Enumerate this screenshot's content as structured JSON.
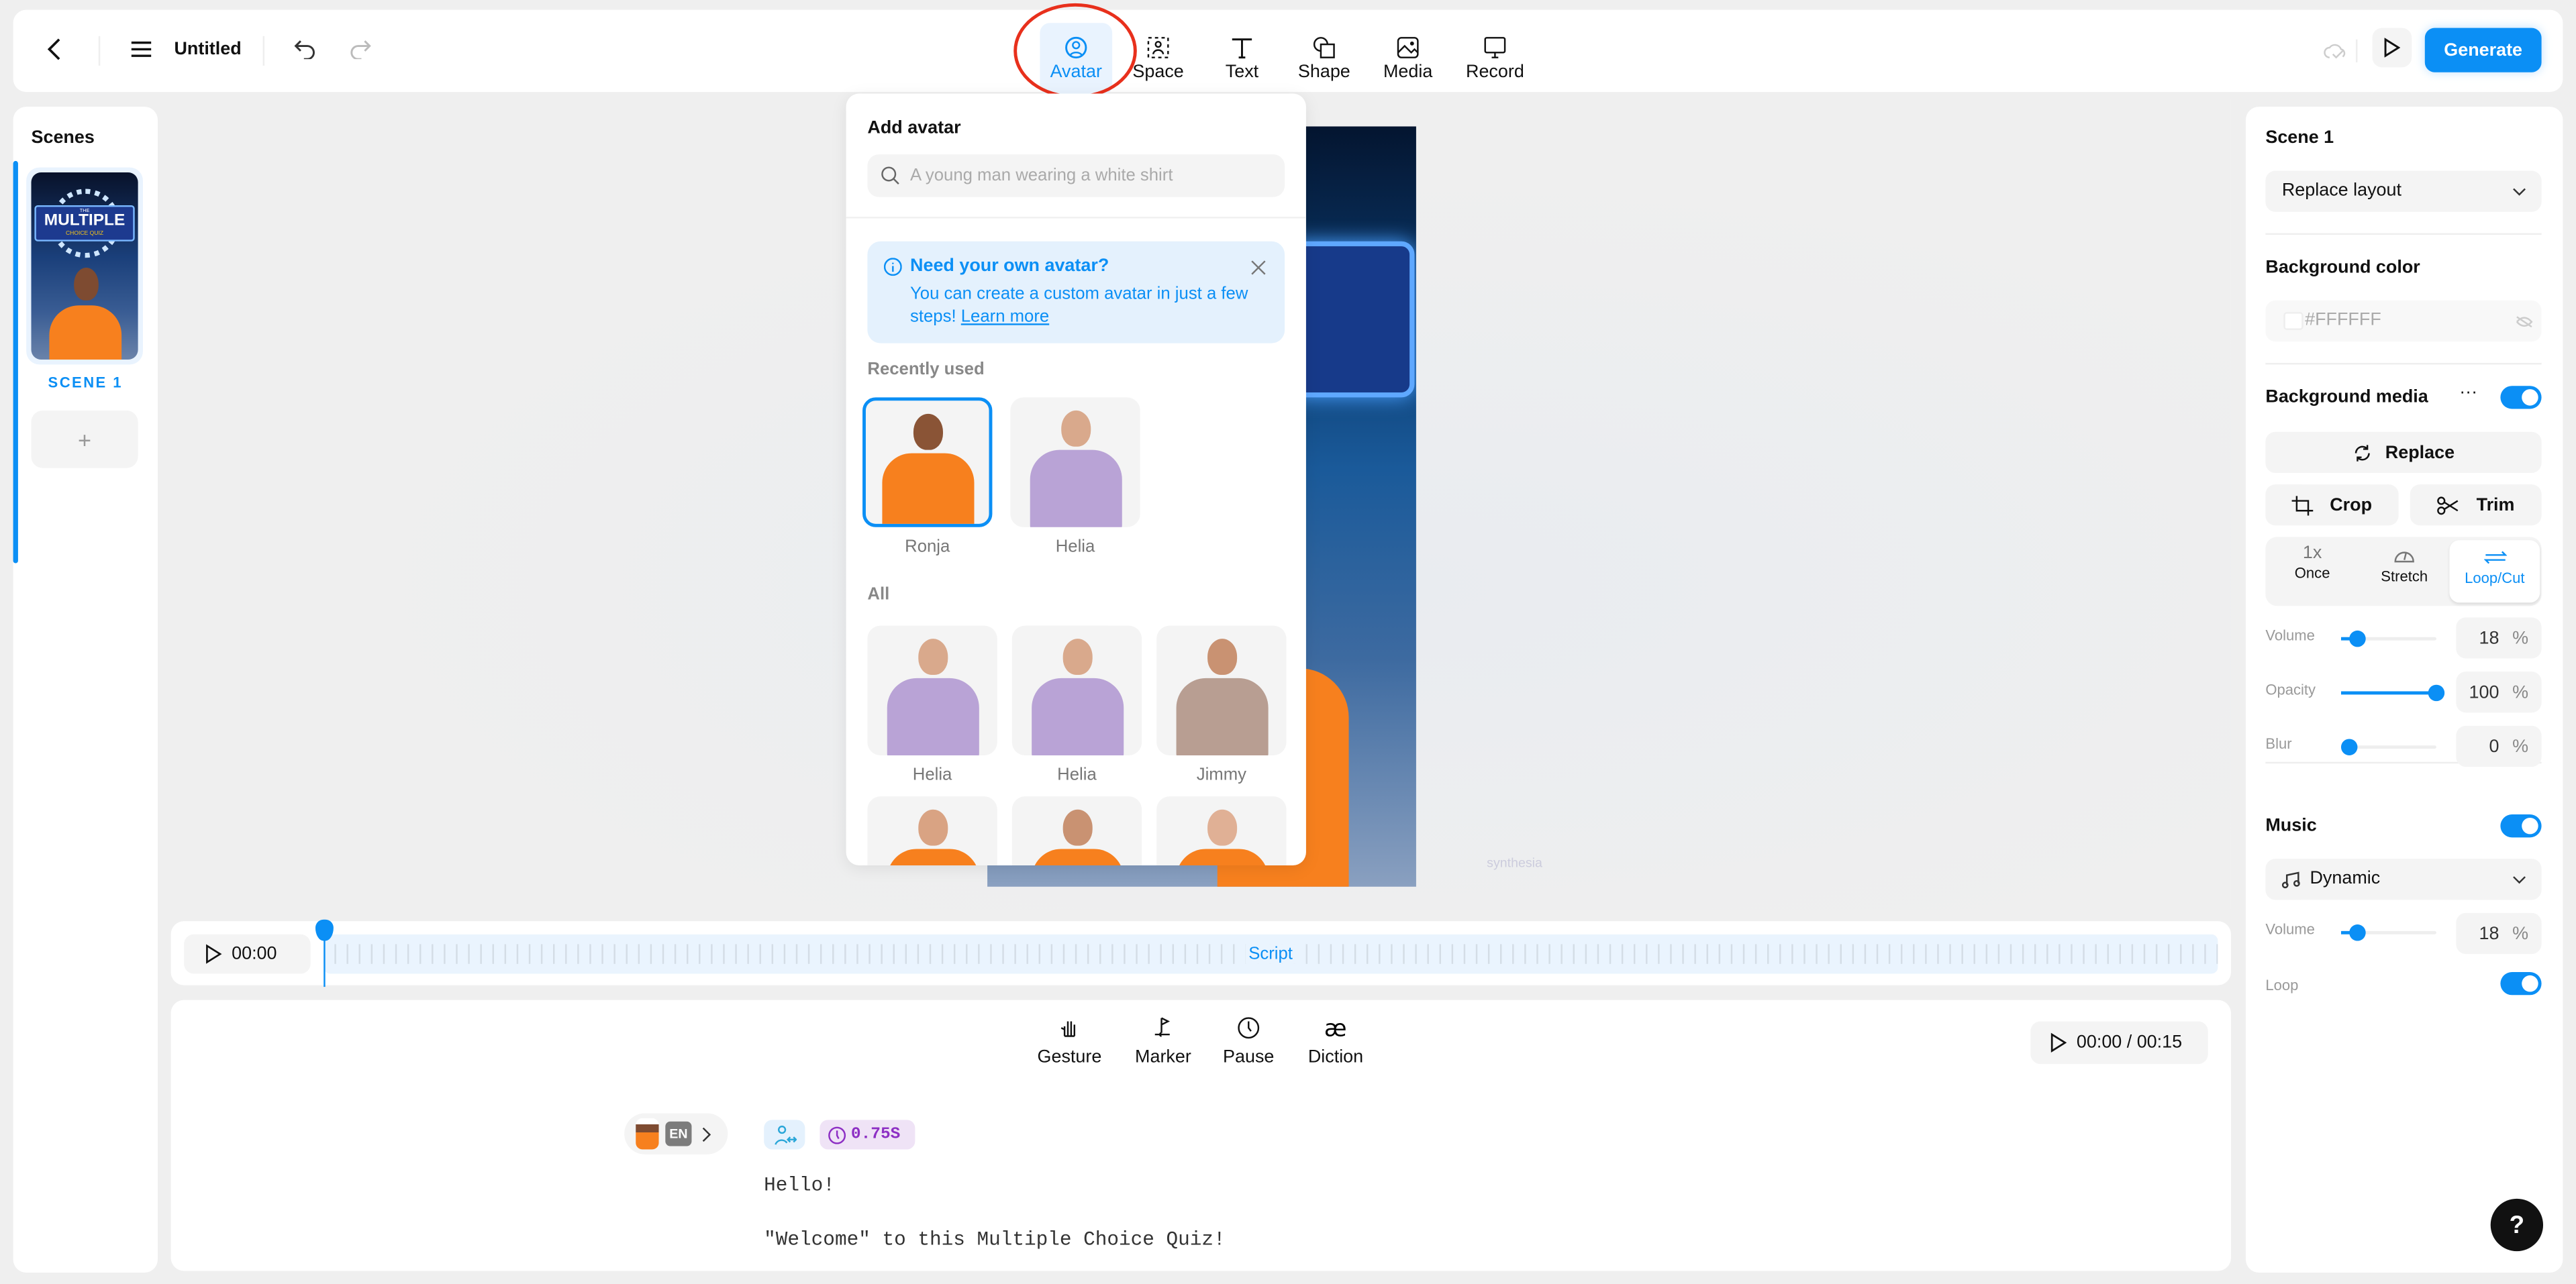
{
  "topbar": {
    "title": "Untitled",
    "generate_label": "Generate",
    "tools": [
      {
        "label": "Avatar",
        "icon": "avatar-icon"
      },
      {
        "label": "Space",
        "icon": "space-icon"
      },
      {
        "label": "Text",
        "icon": "text-icon"
      },
      {
        "label": "Shape",
        "icon": "shape-icon"
      },
      {
        "label": "Media",
        "icon": "media-icon"
      },
      {
        "label": "Record",
        "icon": "record-icon"
      }
    ]
  },
  "scenes": {
    "title": "Scenes",
    "items": [
      {
        "label": "SCENE 1",
        "thumb_title": "MULTIPLE",
        "thumb_top": "THE",
        "thumb_sub": "CHOICE QUIZ"
      }
    ],
    "add_label": "+"
  },
  "avatar_popup": {
    "title": "Add avatar",
    "search_placeholder": "A young man wearing a white shirt",
    "banner": {
      "title": "Need your own avatar?",
      "text": "You can create a custom avatar in just a few steps!",
      "link": "Learn more"
    },
    "recent_label": "Recently used",
    "recent": [
      {
        "name": "Ronja",
        "selected": true,
        "shirt": "#f7801e",
        "skin": "#8a5436"
      },
      {
        "name": "Helia",
        "selected": false,
        "shirt": "#b9a3d6",
        "skin": "#d9a98c"
      }
    ],
    "all_label": "All",
    "all": [
      {
        "name": "Helia",
        "shirt": "#b9a3d6",
        "skin": "#d9a98c"
      },
      {
        "name": "Helia",
        "shirt": "#b9a3d6",
        "skin": "#d9a98c"
      },
      {
        "name": "Jimmy",
        "shirt": "#b89e92",
        "skin": "#c99272"
      },
      {
        "name": "",
        "shirt": "#f7801e",
        "skin": "#d9a383"
      },
      {
        "name": "",
        "shirt": "#f7801e",
        "skin": "#c99272"
      },
      {
        "name": "",
        "shirt": "#f7801e",
        "skin": "#e0b095"
      }
    ]
  },
  "canvas": {
    "watermark": "synthesia"
  },
  "timeline": {
    "time": "00:00",
    "track_label": "Script"
  },
  "script": {
    "tools": [
      {
        "label": "Gesture",
        "icon": "hand-icon"
      },
      {
        "label": "Marker",
        "icon": "marker-icon"
      },
      {
        "label": "Pause",
        "icon": "clock-icon"
      },
      {
        "label": "Diction",
        "icon": "ae"
      }
    ],
    "time": "00:00 / 00:15",
    "lang": "EN",
    "pause_badge": "0.75S",
    "lines": [
      "Hello!",
      "\"Welcome\" to this Multiple Choice Quiz!"
    ]
  },
  "right": {
    "scene_title": "Scene 1",
    "layout_label": "Replace layout",
    "bg_color_label": "Background color",
    "bg_color_value": "#FFFFFF",
    "bg_media_label": "Background media",
    "bg_media_on": true,
    "replace_label": "Replace",
    "crop_label": "Crop",
    "trim_label": "Trim",
    "modes": [
      {
        "top": "1x",
        "label": "Once"
      },
      {
        "top": "",
        "label": "Stretch"
      },
      {
        "top": "",
        "label": "Loop/Cut",
        "active": true
      }
    ],
    "volume_label": "Volume",
    "volume": 18,
    "opacity_label": "Opacity",
    "opacity": 100,
    "blur_label": "Blur",
    "blur": 0,
    "pct": "%",
    "music_label": "Music",
    "music_on": true,
    "music_track": "Dynamic",
    "music_volume_label": "Volume",
    "music_volume": 18,
    "loop_label": "Loop",
    "loop_on": true
  },
  "help_label": "?",
  "colors": {
    "accent": "#0b8ff5",
    "highlight": "#e9f3fe",
    "pause_badge": "#efe3f6",
    "pause_text": "#8d2fc4"
  }
}
